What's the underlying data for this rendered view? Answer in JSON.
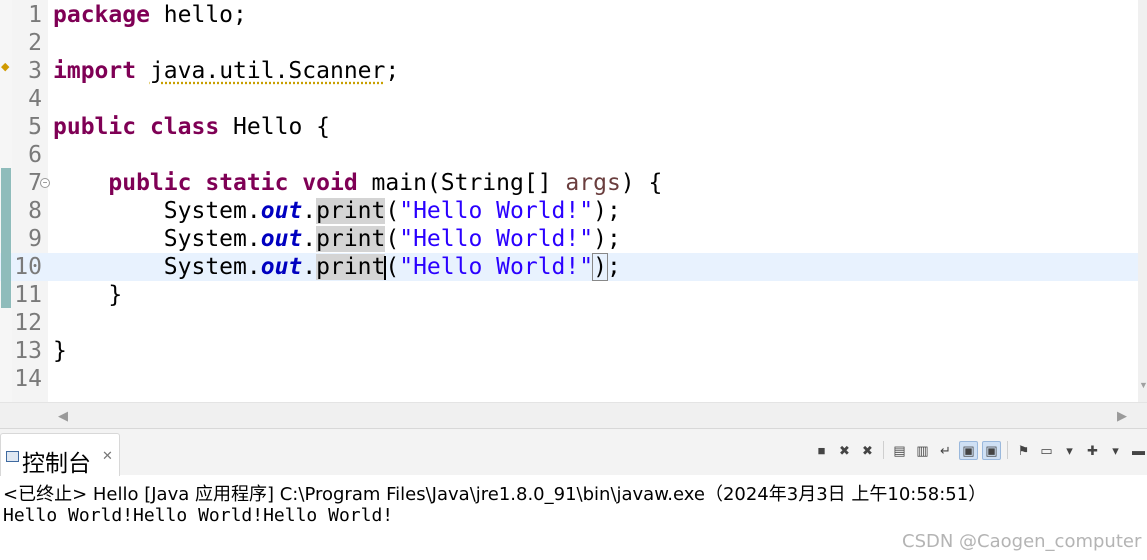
{
  "editor": {
    "lines": [
      {
        "n": "1",
        "tokens": [
          {
            "t": "package",
            "c": "kw"
          },
          {
            "t": " hello;"
          }
        ]
      },
      {
        "n": "2",
        "tokens": []
      },
      {
        "n": "3",
        "tokens": [
          {
            "t": "import",
            "c": "kw"
          },
          {
            "t": " "
          },
          {
            "t": "java.util.Scanner",
            "c": "warn-line"
          },
          {
            "t": ";"
          }
        ]
      },
      {
        "n": "4",
        "tokens": []
      },
      {
        "n": "5",
        "tokens": [
          {
            "t": "public",
            "c": "kw"
          },
          {
            "t": " "
          },
          {
            "t": "class",
            "c": "kw"
          },
          {
            "t": " Hello {"
          }
        ]
      },
      {
        "n": "6",
        "tokens": []
      },
      {
        "n": "7",
        "tokens": [
          {
            "t": "    "
          },
          {
            "t": "public",
            "c": "kw"
          },
          {
            "t": " "
          },
          {
            "t": "static",
            "c": "kw"
          },
          {
            "t": " "
          },
          {
            "t": "void",
            "c": "kw"
          },
          {
            "t": " main(String[] "
          },
          {
            "t": "args",
            "c": "param"
          },
          {
            "t": ") {"
          }
        ]
      },
      {
        "n": "8",
        "tokens": [
          {
            "t": "        System."
          },
          {
            "t": "out",
            "c": "fld"
          },
          {
            "t": "."
          },
          {
            "t": "print",
            "c": "occ"
          },
          {
            "t": "("
          },
          {
            "t": "\"Hello World!\"",
            "c": "str"
          },
          {
            "t": ");"
          }
        ]
      },
      {
        "n": "9",
        "tokens": [
          {
            "t": "        System."
          },
          {
            "t": "out",
            "c": "fld"
          },
          {
            "t": "."
          },
          {
            "t": "print",
            "c": "occ"
          },
          {
            "t": "("
          },
          {
            "t": "\"Hello World!\"",
            "c": "str"
          },
          {
            "t": ");"
          }
        ]
      },
      {
        "n": "10",
        "current": true,
        "tokens": [
          {
            "t": "        System."
          },
          {
            "t": "out",
            "c": "fld"
          },
          {
            "t": "."
          },
          {
            "t": "print",
            "c": "occ"
          },
          {
            "t": "",
            "c": "caret"
          },
          {
            "t": "("
          },
          {
            "t": "\"Hello World!\"",
            "c": "str"
          },
          {
            "t": ")",
            "c": "bracket"
          },
          {
            "t": ";"
          }
        ]
      },
      {
        "n": "11",
        "tokens": [
          {
            "t": "    }"
          }
        ]
      },
      {
        "n": "12",
        "tokens": []
      },
      {
        "n": "13",
        "tokens": [
          {
            "t": "}"
          }
        ]
      },
      {
        "n": "14",
        "tokens": []
      }
    ]
  },
  "console": {
    "tab_label": "控制台",
    "tab_close": "✕",
    "status": "<已终止> Hello [Java 应用程序] C:\\Program Files\\Java\\jre1.8.0_91\\bin\\javaw.exe（2024年3月3日 上午10:58:51）",
    "output": "Hello World!Hello World!Hello World!",
    "toolbar": [
      {
        "name": "terminate-icon",
        "glyph": "■"
      },
      {
        "name": "remove-launch-icon",
        "glyph": "✖"
      },
      {
        "name": "remove-all-terminated-icon",
        "glyph": "✖"
      },
      {
        "sep": true
      },
      {
        "name": "clear-console-icon",
        "glyph": "▤"
      },
      {
        "name": "scroll-lock-icon",
        "glyph": "▥"
      },
      {
        "name": "word-wrap-icon",
        "glyph": "↵"
      },
      {
        "name": "show-on-stdout-icon",
        "glyph": "▣",
        "active": true
      },
      {
        "name": "show-on-stderr-icon",
        "glyph": "▣",
        "active": true
      },
      {
        "sep": true
      },
      {
        "name": "pin-console-icon",
        "glyph": "⚑"
      },
      {
        "name": "display-console-icon",
        "glyph": "▭"
      },
      {
        "name": "display-console-dropdown-icon",
        "glyph": "▾"
      },
      {
        "name": "open-console-icon",
        "glyph": "✚"
      },
      {
        "name": "open-console-dropdown-icon",
        "glyph": "▾"
      },
      {
        "name": "minimize-icon",
        "glyph": "▬"
      }
    ]
  },
  "watermark": "CSDN @Caogen_computer",
  "colors": {
    "keyword": "#7f0055",
    "string": "#2a00ff",
    "field": "#0000c0",
    "current_line": "#e8f2fe"
  }
}
